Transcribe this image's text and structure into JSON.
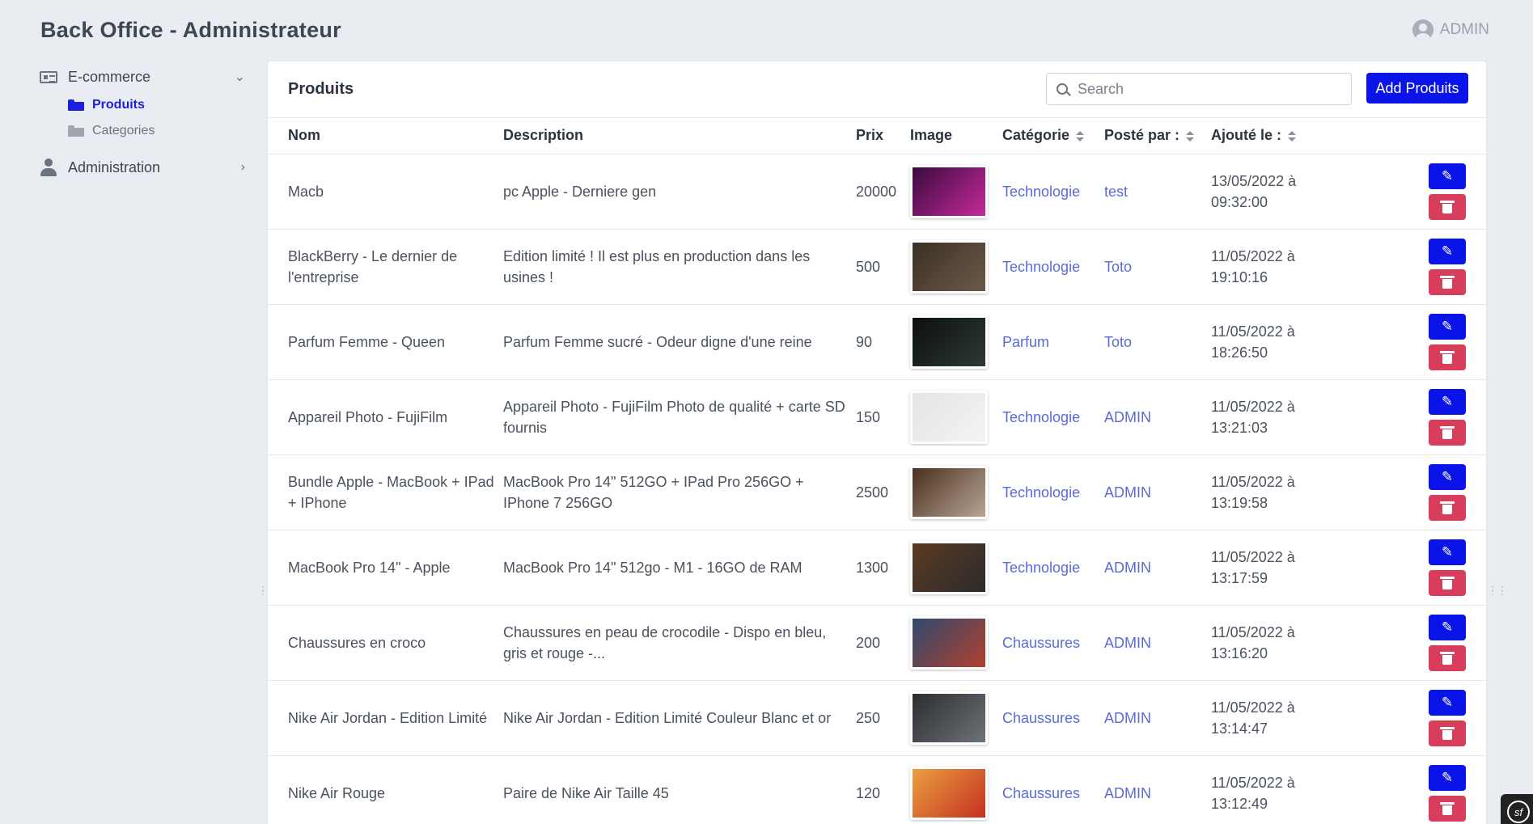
{
  "app": {
    "title": "Back Office - Administrateur",
    "user": "ADMIN"
  },
  "sidebar": {
    "sections": [
      {
        "label": "E-commerce",
        "icon": "newspaper-icon",
        "expanded": true,
        "items": [
          {
            "label": "Produits",
            "active": true
          },
          {
            "label": "Categories",
            "active": false
          }
        ]
      },
      {
        "label": "Administration",
        "icon": "user-icon",
        "expanded": false
      }
    ]
  },
  "panel": {
    "title": "Produits",
    "search_placeholder": "Search",
    "add_label": "Add Produits"
  },
  "table": {
    "headers": {
      "nom": "Nom",
      "description": "Description",
      "prix": "Prix",
      "image": "Image",
      "categorie": "Catégorie",
      "poste_par": "Posté par :",
      "ajoute_le": "Ajouté le :"
    },
    "rows": [
      {
        "nom": "Macb",
        "description": "pc Apple - Derniere gen",
        "prix": "20000",
        "categorie": "Technologie",
        "poste_par": "test",
        "date": "13/05/2022 à",
        "time": "09:32:00",
        "thumb_colors": [
          "#3a0a3e",
          "#c42a9a"
        ]
      },
      {
        "nom": "BlackBerry - Le dernier de l'entreprise",
        "description": "Edition limité ! Il est plus en production dans les usines !",
        "prix": "500",
        "categorie": "Technologie",
        "poste_par": "Toto",
        "date": "11/05/2022 à",
        "time": "19:10:16",
        "thumb_colors": [
          "#3b3026",
          "#6b5a48"
        ]
      },
      {
        "nom": "Parfum Femme - Queen",
        "description": "Parfum Femme sucré - Odeur digne d'une reine",
        "prix": "90",
        "categorie": "Parfum",
        "poste_par": "Toto",
        "date": "11/05/2022 à",
        "time": "18:26:50",
        "thumb_colors": [
          "#0c0f10",
          "#2e3a36"
        ]
      },
      {
        "nom": "Appareil Photo - FujiFilm",
        "description": "Appareil Photo - FujiFilm Photo de qualité + carte SD fournis",
        "prix": "150",
        "categorie": "Technologie",
        "poste_par": "ADMIN",
        "date": "11/05/2022 à",
        "time": "13:21:03",
        "thumb_colors": [
          "#e4e6e6",
          "#f2f3f3"
        ]
      },
      {
        "nom": "Bundle Apple - MacBook + IPad + IPhone",
        "description": "MacBook Pro 14\" 512GO + IPad Pro 256GO + IPhone 7 256GO",
        "prix": "2500",
        "categorie": "Technologie",
        "poste_par": "ADMIN",
        "date": "11/05/2022 à",
        "time": "13:19:58",
        "thumb_colors": [
          "#4a2e1e",
          "#b8a694"
        ]
      },
      {
        "nom": "MacBook Pro 14\" - Apple",
        "description": "MacBook Pro 14\" 512go - M1 - 16GO de RAM",
        "prix": "1300",
        "categorie": "Technologie",
        "poste_par": "ADMIN",
        "date": "11/05/2022 à",
        "time": "13:17:59",
        "thumb_colors": [
          "#5b3a22",
          "#2b2b2b"
        ]
      },
      {
        "nom": "Chaussures en croco",
        "description": "Chaussures en peau de crocodile - Dispo en bleu, gris et rouge -...",
        "prix": "200",
        "categorie": "Chaussures",
        "poste_par": "ADMIN",
        "date": "11/05/2022 à",
        "time": "13:16:20",
        "thumb_colors": [
          "#2e4a6e",
          "#b0402e"
        ]
      },
      {
        "nom": "Nike Air Jordan - Edition Limité",
        "description": "Nike Air Jordan - Edition Limité Couleur Blanc et or",
        "prix": "250",
        "categorie": "Chaussures",
        "poste_par": "ADMIN",
        "date": "11/05/2022 à",
        "time": "13:14:47",
        "thumb_colors": [
          "#2a2d30",
          "#6e7378"
        ]
      },
      {
        "nom": "Nike Air Rouge",
        "description": "Paire de Nike Air Taille 45",
        "prix": "120",
        "categorie": "Chaussures",
        "poste_par": "ADMIN",
        "date": "11/05/2022 à",
        "time": "13:12:49",
        "thumb_colors": [
          "#e8a040",
          "#c43020"
        ]
      }
    ]
  },
  "colors": {
    "primary": "#0a14e8",
    "danger": "#d93d5c",
    "link": "#5a6ad8"
  },
  "footer": {
    "badge": "sf"
  }
}
